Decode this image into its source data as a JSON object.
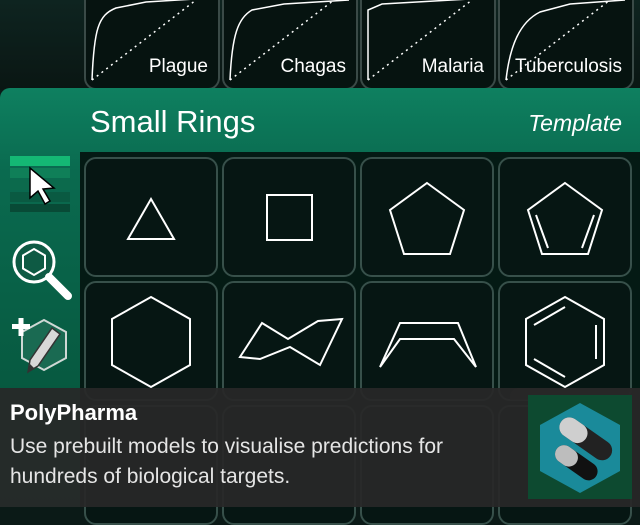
{
  "models": [
    {
      "label": "Plague"
    },
    {
      "label": "Chagas"
    },
    {
      "label": "Malaria"
    },
    {
      "label": "Tuberculosis"
    }
  ],
  "panel": {
    "title": "Small Rings",
    "mode": "Template"
  },
  "tools": [
    "select-tool-icon",
    "search-tool-icon",
    "edit-tool-icon"
  ],
  "templates": [
    "triangle",
    "square",
    "pentagon",
    "cyclopentadiene",
    "hexagon",
    "cyclohexane-chair",
    "cyclohexane-boat",
    "benzene"
  ],
  "notification": {
    "title": "PolyPharma",
    "description": "Use prebuilt models to visualise predictions for hundreds of biological targets."
  },
  "colors": {
    "panel": "#0a6a4f",
    "tile": "#061613",
    "tile_border": "#37504a"
  }
}
